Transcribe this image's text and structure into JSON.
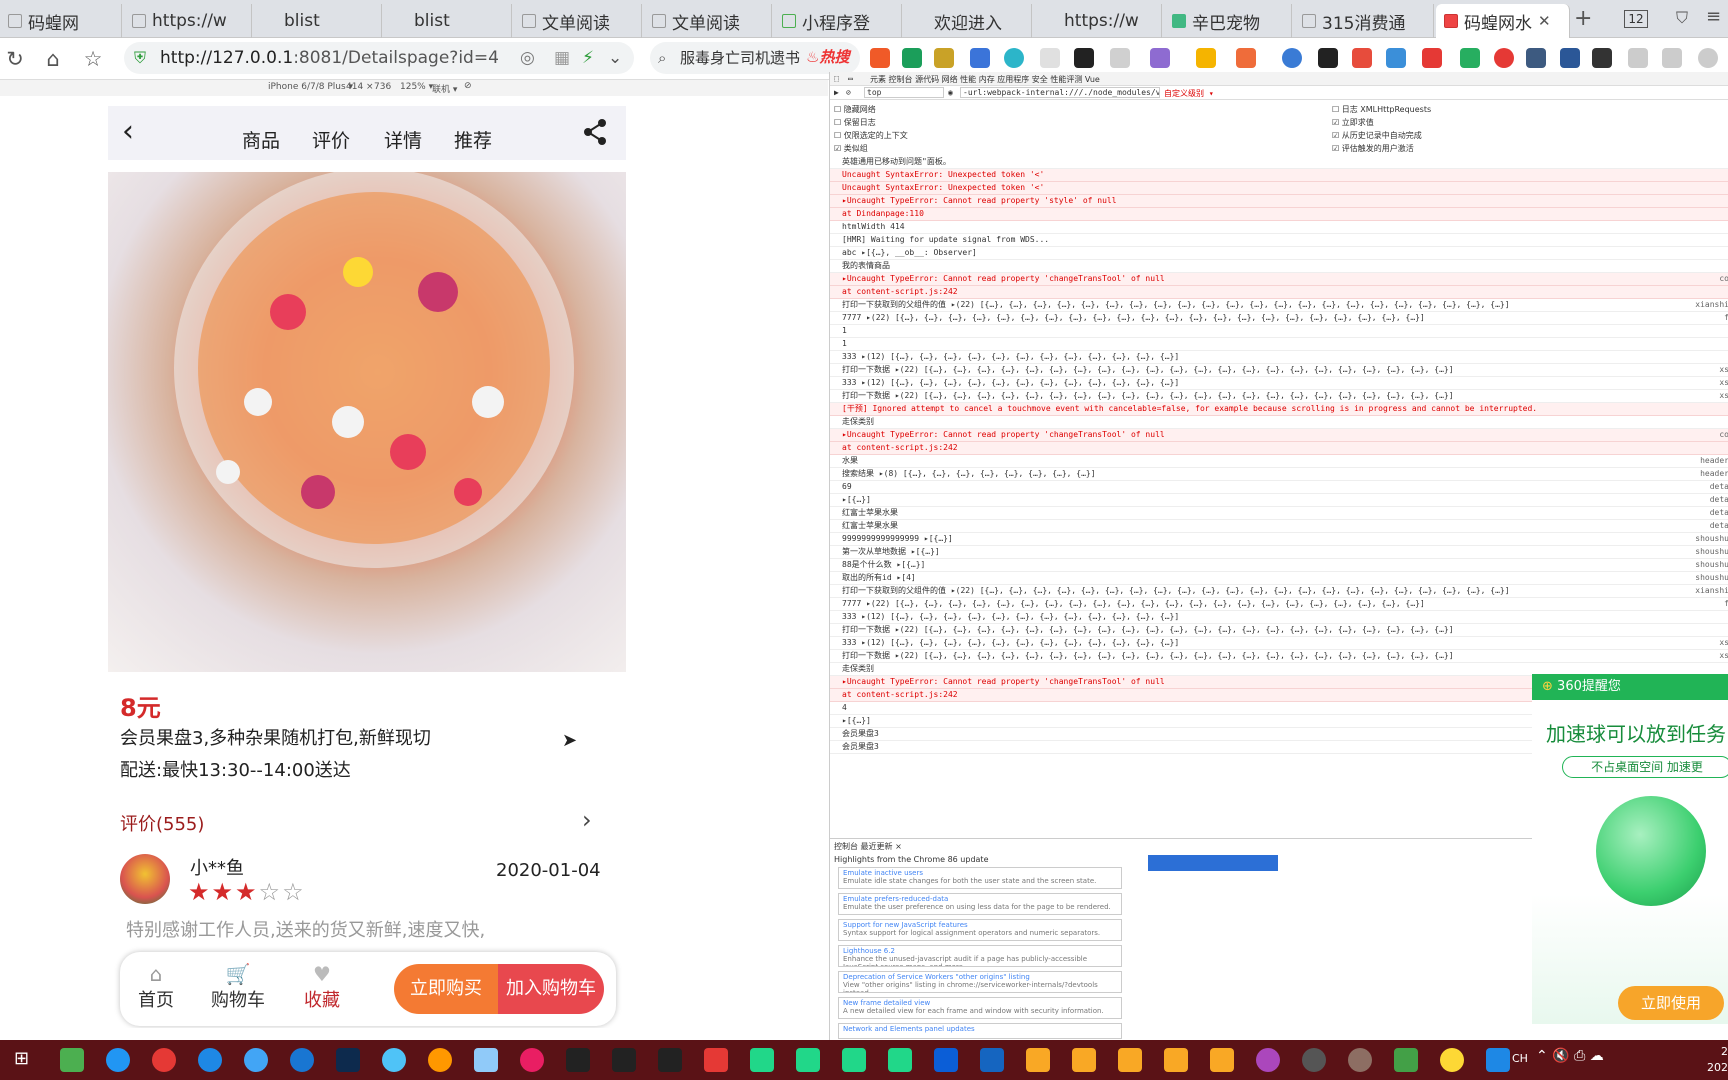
{
  "browser": {
    "tabs": [
      {
        "label": "码蝗网"
      },
      {
        "label": "https://w"
      },
      {
        "label": "blist"
      },
      {
        "label": "blist"
      },
      {
        "label": "文单阅读"
      },
      {
        "label": "文单阅读"
      },
      {
        "label": "小程序登"
      },
      {
        "label": "欢迎进入"
      },
      {
        "label": "https://w"
      },
      {
        "label": "辛巴宠物"
      },
      {
        "label": "315消费通"
      },
      {
        "label": "码蝗网水"
      }
    ],
    "tab_count": "12",
    "url_host": "http://127.0.0.1",
    "url_rest": ":8081/Detailspage?id=4",
    "search_text": "服毒身亡司机遗书",
    "search_badge": "热搜"
  },
  "device_toolbar": {
    "device": "iPhone 6/7/8 Plus ▾",
    "width": "414",
    "height": "736",
    "zoom": "125% ▾",
    "network": "联机 ▾"
  },
  "phone": {
    "nav_tabs": [
      "商品",
      "评价",
      "详情",
      "推荐"
    ],
    "price": "8元",
    "product_name": "会员果盘3,多种杂果随机打包,新鲜现切",
    "delivery": "配送:最快13:30--14:00送达",
    "review_link": "评价(555)",
    "review": {
      "user": "小**鱼",
      "rating": 3,
      "stars_filled": "★★★",
      "stars_empty": "☆☆",
      "date": "2020-01-04",
      "text": "特别感谢工作人员,送来的货又新鲜,速度又快,"
    },
    "bottom_bar": {
      "home": "首页",
      "cart": "购物车",
      "favorite": "收藏",
      "buy_now": "立即购买",
      "add_cart": "加入购物车"
    }
  },
  "devtools": {
    "tabs": "元素   控制台   源代码   网络   性能   内存   应用程序   安全   性能评测   Vue",
    "filter_context": "top",
    "filter_text": "-url:webpack-internal:///./node_modules/vue/dist/vue.n",
    "filter_level": "自定义级别 ▾",
    "settings_left": [
      "隐藏网络",
      "保留日志",
      "仅限选定的上下文",
      "类似组"
    ],
    "settings_right": [
      "日志 XMLHttpRequests",
      "立即求值",
      "从历史记录中自动完成",
      "评估触发的用户激活"
    ],
    "console_lines": [
      {
        "text": "英雄通用已移动到问题\"面板。",
        "type": "info",
        "src": ""
      },
      {
        "text": "Uncaught SyntaxError: Unexpected token '<'",
        "type": "error",
        "src": ""
      },
      {
        "text": "Uncaught SyntaxError: Unexpected token '<'",
        "type": "error",
        "src": ""
      },
      {
        "text": "▸Uncaught TypeError: Cannot read property 'style' of null",
        "type": "error",
        "src": ""
      },
      {
        "text": "    at Dindanpage:110",
        "type": "error",
        "src": ""
      },
      {
        "text": "htmlWidth 414",
        "type": "log",
        "src": ""
      },
      {
        "text": "[HMR] Waiting for update signal from WDS...",
        "type": "log",
        "src": ""
      },
      {
        "text": "abc ▸[{…}, __ob__: Observer]",
        "type": "log",
        "src": ""
      },
      {
        "text": "我的表情商品",
        "type": "log",
        "src": ""
      },
      {
        "text": "▸Uncaught TypeError: Cannot read property 'changeTransTool' of null",
        "type": "error",
        "src": "co"
      },
      {
        "text": "    at content-script.js:242",
        "type": "error",
        "src": ""
      },
      {
        "text": "打印一下获取到的父组件的值 ▸(22) [{…}, {…}, {…}, {…}, {…}, {…}, {…}, {…}, {…}, {…}, {…}, {…}, {…}, {…}, {…}, {…}, {…}, {…}, {…}, {…}, {…}, {…}]",
        "type": "log",
        "src": "xianshi"
      },
      {
        "text": "7777 ▸(22) [{…}, {…}, {…}, {…}, {…}, {…}, {…}, {…}, {…}, {…}, {…}, {…}, {…}, {…}, {…}, {…}, {…}, {…}, {…}, {…}, {…}, {…}]",
        "type": "log",
        "src": "f"
      },
      {
        "text": "1",
        "type": "log",
        "src": ""
      },
      {
        "text": "1",
        "type": "log",
        "src": ""
      },
      {
        "text": "333 ▸(12) [{…}, {…}, {…}, {…}, {…}, {…}, {…}, {…}, {…}, {…}, {…}, {…}]",
        "type": "log",
        "src": ""
      },
      {
        "text": "打印一下数据 ▸(22) [{…}, {…}, {…}, {…}, {…}, {…}, {…}, {…}, {…}, {…}, {…}, {…}, {…}, {…}, {…}, {…}, {…}, {…}, {…}, {…}, {…}, {…}]",
        "type": "log",
        "src": "xs"
      },
      {
        "text": "333 ▸(12) [{…}, {…}, {…}, {…}, {…}, {…}, {…}, {…}, {…}, {…}, {…}, {…}]",
        "type": "log",
        "src": "xs"
      },
      {
        "text": "打印一下数据 ▸(22) [{…}, {…}, {…}, {…}, {…}, {…}, {…}, {…}, {…}, {…}, {…}, {…}, {…}, {…}, {…}, {…}, {…}, {…}, {…}, {…}, {…}, {…}]",
        "type": "log",
        "src": "xs"
      },
      {
        "text": "[干预] Ignored attempt to cancel a touchmove event with cancelable=false, for example because scrolling is in progress and cannot be interrupted.",
        "type": "error",
        "src": ""
      },
      {
        "text": "走保类别",
        "type": "log",
        "src": ""
      },
      {
        "text": "▸Uncaught TypeError: Cannot read property 'changeTransTool' of null",
        "type": "error",
        "src": "co"
      },
      {
        "text": "    at content-script.js:242",
        "type": "error",
        "src": ""
      },
      {
        "text": "水果",
        "type": "log",
        "src": "header"
      },
      {
        "text": "搜索结果 ▸(8) [{…}, {…}, {…}, {…}, {…}, {…}, {…}, {…}]",
        "type": "log",
        "src": "header"
      },
      {
        "text": "69",
        "type": "log",
        "src": "deta"
      },
      {
        "text": "▸[{…}]",
        "type": "log",
        "src": "deta"
      },
      {
        "text": "红富士苹果水果",
        "type": "log",
        "src": "deta"
      },
      {
        "text": "红富士苹果水果",
        "type": "log",
        "src": "deta"
      },
      {
        "text": "9999999999999999 ▸[{…}]",
        "type": "log",
        "src": "shoushu"
      },
      {
        "text": "第一次从草地数据 ▸[{…}]",
        "type": "log",
        "src": "shoushu"
      },
      {
        "text": "88是个什么数 ▸[{…}]",
        "type": "log",
        "src": "shoushu"
      },
      {
        "text": "取出的所有id ▸[4]",
        "type": "log",
        "src": "shoushu"
      },
      {
        "text": "打印一下获取到的父组件的值 ▸(22) [{…}, {…}, {…}, {…}, {…}, {…}, {…}, {…}, {…}, {…}, {…}, {…}, {…}, {…}, {…}, {…}, {…}, {…}, {…}, {…}, {…}, {…}]",
        "type": "log",
        "src": "xianshi"
      },
      {
        "text": "7777 ▸(22) [{…}, {…}, {…}, {…}, {…}, {…}, {…}, {…}, {…}, {…}, {…}, {…}, {…}, {…}, {…}, {…}, {…}, {…}, {…}, {…}, {…}, {…}]",
        "type": "log",
        "src": "f"
      },
      {
        "text": "333 ▸(12) [{…}, {…}, {…}, {…}, {…}, {…}, {…}, {…}, {…}, {…}, {…}, {…}]",
        "type": "log",
        "src": ""
      },
      {
        "text": "打印一下数据 ▸(22) [{…}, {…}, {…}, {…}, {…}, {…}, {…}, {…}, {…}, {…}, {…}, {…}, {…}, {…}, {…}, {…}, {…}, {…}, {…}, {…}, {…}, {…}]",
        "type": "log",
        "src": ""
      },
      {
        "text": "333 ▸(12) [{…}, {…}, {…}, {…}, {…}, {…}, {…}, {…}, {…}, {…}, {…}, {…}]",
        "type": "log",
        "src": "xs"
      },
      {
        "text": "打印一下数据 ▸(22) [{…}, {…}, {…}, {…}, {…}, {…}, {…}, {…}, {…}, {…}, {…}, {…}, {…}, {…}, {…}, {…}, {…}, {…}, {…}, {…}, {…}, {…}]",
        "type": "log",
        "src": "xs"
      },
      {
        "text": "走保类别",
        "type": "log",
        "src": ""
      },
      {
        "text": "▸Uncaught TypeError: Cannot read property 'changeTransTool' of null",
        "type": "error",
        "src": ""
      },
      {
        "text": "    at content-script.js:242",
        "type": "error",
        "src": ""
      },
      {
        "text": "4",
        "type": "log",
        "src": ""
      },
      {
        "text": "▸[{…}]",
        "type": "log",
        "src": ""
      },
      {
        "text": "会员果盘3",
        "type": "log",
        "src": ""
      },
      {
        "text": "会员果盘3",
        "type": "log",
        "src": ""
      }
    ],
    "drawer_tabs": "控制台   最近更新 ×",
    "drawer_title": "Highlights from the Chrome 86 update",
    "whats_new": [
      {
        "title": "Emulate inactive users",
        "desc": "Emulate idle state changes for both the user state and the screen state."
      },
      {
        "title": "Emulate prefers-reduced-data",
        "desc": "Emulate the user preference on using less data for the page to be rendered."
      },
      {
        "title": "Support for new JavaScript features",
        "desc": "Syntax support for logical assignment operators and numeric separators."
      },
      {
        "title": "Lighthouse 6.2",
        "desc": "Enhance the unused-javascript audit if a page has publicly-accessible JavaScript source maps, and more."
      },
      {
        "title": "Deprecation of Service Workers \"other origins\" listing",
        "desc": "View \"other origins\" listing in chrome://serviceworker-internals/?devtools instead."
      },
      {
        "title": "New frame detailed view",
        "desc": "A new detailed view for each frame and window with security information."
      },
      {
        "title": "Network and Elements panel updates",
        "desc": ""
      }
    ]
  },
  "popup360": {
    "header": "360提醒您",
    "title": "加速球可以放到任务",
    "subtitle": "不占桌面空间  加速更",
    "button": "立即使用"
  },
  "taskbar": {
    "lang": "CH",
    "clock_line1": "2",
    "clock_line2": "202"
  }
}
